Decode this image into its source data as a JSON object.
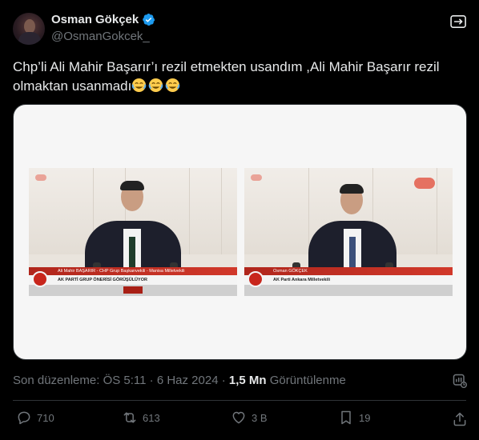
{
  "tweet": {
    "author": {
      "display_name": "Osman Gökçek",
      "handle": "@OsmanGokcek_",
      "verified": true
    },
    "text": "Chp’li Ali Mahir Başarır’ı rezil etmekten usandım ,Ali Mahir Başarır rezil olmaktan usanmadı",
    "emojis": [
      "face-with-tears-of-joy",
      "face-with-tears-of-joy",
      "face-with-tears-of-joy"
    ],
    "media": {
      "left_frame": {
        "name_line": "Ali Mahir BAŞARIR - CHP Grup Başkanvekili - Manisa Milletvekili",
        "subtitle": "AK PARTİ GRUP ÖNERİSİ GÖRÜŞÜLÜYOR"
      },
      "right_frame": {
        "name_line": "Osman GÖKÇEK",
        "subtitle": "AK Parti Ankara Milletvekili"
      }
    },
    "edited_label": "Son düzenleme: ÖS 5:11 · 6 Haz 2024 ·",
    "views_count": "1,5 Mn",
    "views_label": "Görüntülenme"
  },
  "actions": {
    "replies": "710",
    "reposts": "613",
    "likes": "3 B",
    "bookmarks": "19"
  },
  "colors": {
    "background": "#000000",
    "text": "#e7e9ea",
    "muted": "#71767b",
    "verified": "#1d9bf0",
    "divider": "#2f3336"
  }
}
